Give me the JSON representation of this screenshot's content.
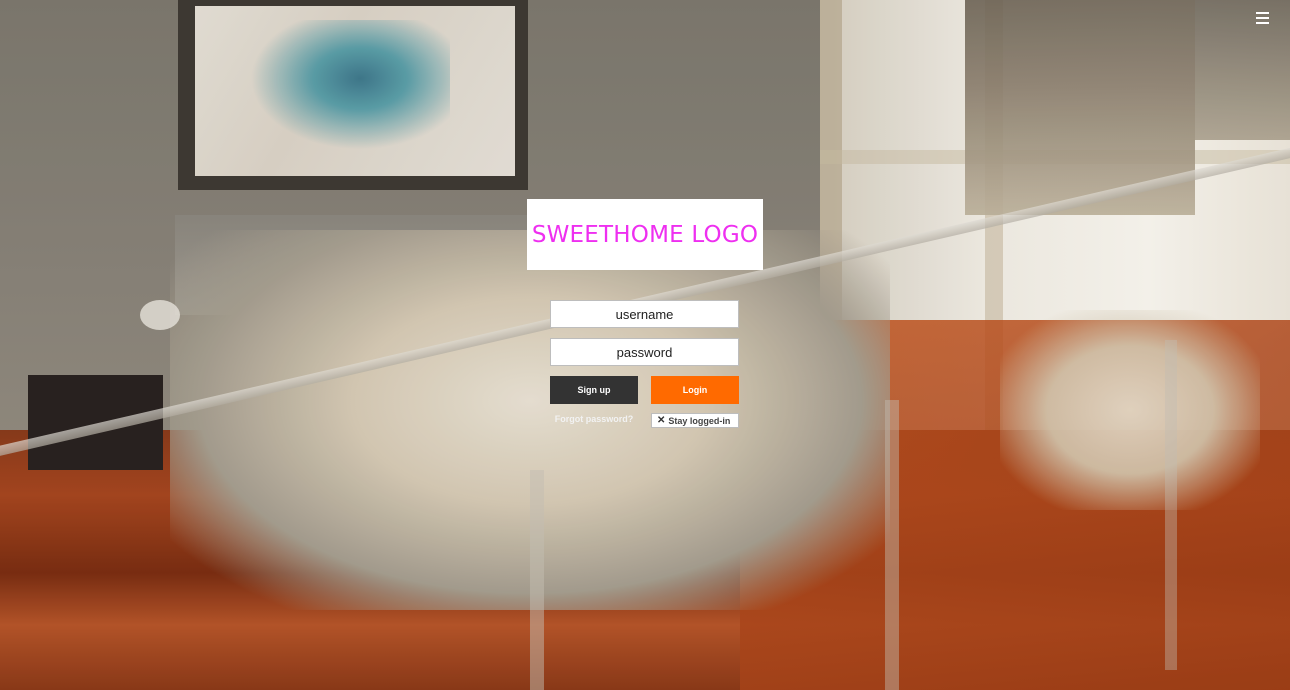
{
  "logo": {
    "text": "SWEETHOME LOGO",
    "color": "#ee2ff0"
  },
  "menu": {
    "icon": "hamburger-menu-icon"
  },
  "login_form": {
    "username_placeholder": "username",
    "password_placeholder": "password",
    "signup_label": "Sign up",
    "login_label": "Login",
    "forgot_label": "Forgot password?",
    "stay_logged_in_label": "Stay logged-in",
    "stay_logged_in_icon": "x-mark-icon"
  },
  "colors": {
    "login_button": "#ff6a00",
    "signup_button": "#333333"
  },
  "background": {
    "scene": "blurred-bedroom-photo"
  }
}
